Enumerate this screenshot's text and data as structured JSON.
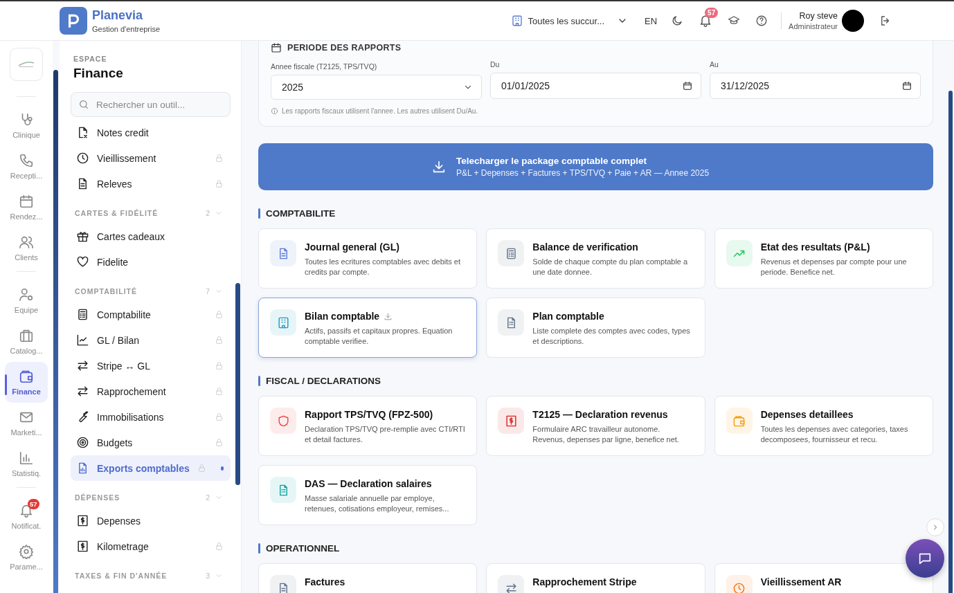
{
  "header": {
    "brand": "Planevia",
    "tagline": "Gestion d'entreprise",
    "branch": "Toutes les succur...",
    "language": "EN",
    "notifications": "57",
    "user_name": "Roy steve",
    "user_role": "Administrateur"
  },
  "rail": {
    "items": [
      {
        "label": "Clinique",
        "selected": false
      },
      {
        "label": "Recepti...",
        "selected": false
      },
      {
        "label": "Rendez...",
        "selected": false
      },
      {
        "label": "Clients",
        "selected": false
      },
      {
        "label": "Equipe",
        "selected": false
      },
      {
        "label": "Catalog...",
        "selected": false
      },
      {
        "label": "Finance",
        "selected": true
      },
      {
        "label": "Marketi...",
        "selected": false
      },
      {
        "label": "Statistiq.",
        "selected": false
      },
      {
        "label": "Notificat.",
        "selected": false,
        "badge": "57"
      },
      {
        "label": "Parame...",
        "selected": false
      }
    ]
  },
  "sidebar": {
    "space_label": "ESPACE",
    "title": "Finance",
    "search_placeholder": "Rechercher un outil...",
    "groups": [
      {
        "items": [
          {
            "label": "Notes credit",
            "locked": false,
            "selected": false
          },
          {
            "label": "Vieillissement",
            "locked": true,
            "selected": false
          },
          {
            "label": "Releves",
            "locked": true,
            "selected": false
          }
        ]
      },
      {
        "heading": "CARTES & FIDÉLITÉ",
        "count": "2",
        "items": [
          {
            "label": "Cartes cadeaux",
            "locked": false,
            "selected": false
          },
          {
            "label": "Fidelite",
            "locked": false,
            "selected": false
          }
        ]
      },
      {
        "heading": "COMPTABILITÉ",
        "count": "7",
        "items": [
          {
            "label": "Comptabilite",
            "locked": true,
            "selected": false
          },
          {
            "label": "GL / Bilan",
            "locked": true,
            "selected": false
          },
          {
            "label": "Stripe ↔ GL",
            "locked": true,
            "selected": false
          },
          {
            "label": "Rapprochement",
            "locked": true,
            "selected": false
          },
          {
            "label": "Immobilisations",
            "locked": true,
            "selected": false
          },
          {
            "label": "Budgets",
            "locked": true,
            "selected": false
          },
          {
            "label": "Exports comptables",
            "locked": true,
            "selected": true
          }
        ]
      },
      {
        "heading": "DÉPENSES",
        "count": "2",
        "items": [
          {
            "label": "Depenses",
            "locked": false,
            "selected": false
          },
          {
            "label": "Kilometrage",
            "locked": true,
            "selected": false
          }
        ]
      },
      {
        "heading": "TAXES & FIN D'ANNÉE",
        "count": "3"
      }
    ]
  },
  "period": {
    "title": "PERIODE DES RAPPORTS",
    "fiscal_label": "Annee fiscale (T2125, TPS/TVQ)",
    "fiscal_value": "2025",
    "from_label": "Du",
    "from_value": "01/01/2025",
    "to_label": "Au",
    "to_value": "31/12/2025",
    "note": "Les rapports fiscaux utilisent l'annee. Les autres utilisent Du/Au."
  },
  "download": {
    "title": "Telecharger le package comptable complet",
    "subtitle": "P&L + Depenses + Factures + TPS/TVQ + Paie + AR — Annee 2025"
  },
  "sections": [
    {
      "title": "COMPTABILITE",
      "cards": [
        {
          "title": "Journal general (GL)",
          "description": "Toutes les ecritures comptables avec debits et credits par compte.",
          "color": "#5b7bd5",
          "selected": false
        },
        {
          "title": "Balance de verification",
          "description": "Solde de chaque compte du plan comptable a une date donnee.",
          "color": "#64748b",
          "selected": false
        },
        {
          "title": "Etat des resultats (P&L)",
          "description": "Revenus et depenses par compte pour une periode. Benefice net.",
          "color": "#22c55e",
          "selected": false
        },
        {
          "title": "Bilan comptable",
          "description": "Actifs, passifs et capitaux propres. Equation comptable verifiee.",
          "color": "#1f9bbf",
          "selected": true
        },
        {
          "title": "Plan comptable",
          "description": "Liste complete des comptes avec codes, types et descriptions.",
          "color": "#64748b",
          "selected": false
        }
      ]
    },
    {
      "title": "FISCAL / DECLARATIONS",
      "cards": [
        {
          "title": "Rapport TPS/TVQ (FPZ-500)",
          "description": "Declaration TPS/TVQ pre-remplie avec CTI/RTI et detail factures.",
          "color": "#ef4444",
          "selected": false
        },
        {
          "title": "T2125 — Declaration revenus",
          "description": "Formulaire ARC travailleur autonome. Revenus, depenses par ligne, benefice net.",
          "color": "#dc2626",
          "selected": false
        },
        {
          "title": "Depenses detaillees",
          "description": "Toutes les depenses avec categories, taxes decomposees, fournisseur et recu.",
          "color": "#f59e0b",
          "selected": false
        },
        {
          "title": "DAS — Declaration salaires",
          "description": "Masse salariale annuelle par employe, retenues, cotisations employeur, remises...",
          "color": "#0ea5a4",
          "selected": false
        }
      ]
    },
    {
      "title": "OPERATIONNEL",
      "cards": [
        {
          "title": "Factures",
          "color": "#64748b",
          "selected": false
        },
        {
          "title": "Rapprochement Stripe",
          "color": "#64748b",
          "selected": false
        },
        {
          "title": "Vieillissement AR",
          "color": "#f97316",
          "selected": false
        }
      ]
    }
  ]
}
